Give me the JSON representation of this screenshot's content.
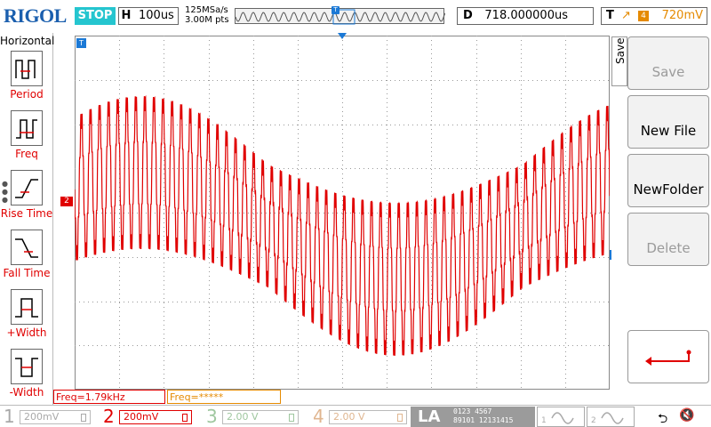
{
  "header": {
    "logo": "RIGOL",
    "run_state": "STOP",
    "timebase_key": "H",
    "timebase_value": "100us",
    "sample_rate": "125MSa/s",
    "memory_depth": "3.00M pts",
    "delay_key": "D",
    "delay_value": "718.000000us",
    "trigger_key": "T",
    "trigger_edge_icon": "rising-edge-icon",
    "trigger_source": "4",
    "trigger_level": "720mV"
  },
  "left_menu": {
    "title": "Horizontal",
    "items": [
      {
        "label": "Period",
        "icon": "period-icon"
      },
      {
        "label": "Freq",
        "icon": "freq-icon"
      },
      {
        "label": "Rise Time",
        "icon": "rise-time-icon"
      },
      {
        "label": "Fall Time",
        "icon": "fall-time-icon"
      },
      {
        "label": "+Width",
        "icon": "pos-width-icon"
      },
      {
        "label": "-Width",
        "icon": "neg-width-icon"
      }
    ]
  },
  "markers": {
    "channel2_marker": "2",
    "trigger_pos_marker": "T",
    "trigger_level_marker": "T"
  },
  "right_menu": {
    "title": "Save",
    "buttons": [
      {
        "label": "Save",
        "enabled": false
      },
      {
        "label": "New File",
        "enabled": true
      },
      {
        "label": "NewFolder",
        "enabled": true
      },
      {
        "label": "Delete",
        "enabled": false
      },
      {
        "label": "",
        "icon": "return-icon"
      }
    ]
  },
  "measurements": {
    "freq1": "Freq=1.79kHz",
    "freq2": "Freq=*****"
  },
  "channels": [
    {
      "num": "1",
      "scale": "200mV",
      "color": "#a9a9a9"
    },
    {
      "num": "2",
      "scale": "200mV",
      "color": "#e00000"
    },
    {
      "num": "3",
      "scale": "2.00 V",
      "color": "#9fc79f"
    },
    {
      "num": "4",
      "scale": "2.00 V",
      "color": "#e0b690"
    }
  ],
  "la": {
    "label": "LA",
    "row1": "0123  4567",
    "row2": "89101 12131415"
  },
  "generators": [
    {
      "num": "1",
      "icon": "sine-wave-icon"
    },
    {
      "num": "2",
      "icon": "sine-wave-icon"
    }
  ],
  "status_icons": [
    "usb-icon",
    "speaker-muted-icon"
  ],
  "colors": {
    "brand": "#1b5fae",
    "run_state": "#25c5cf",
    "trace": "#e00000",
    "trigger": "#e58a00",
    "marker": "#1b79d6"
  }
}
